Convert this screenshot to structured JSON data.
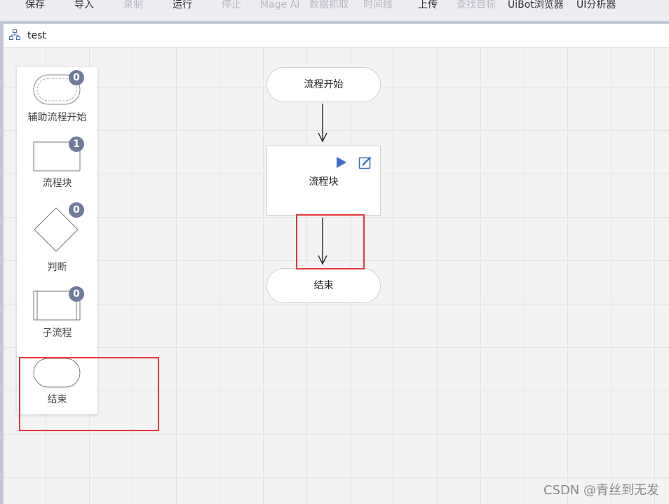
{
  "toolbar": {
    "items": [
      {
        "label": "保存",
        "enabled": true
      },
      {
        "label": "导入",
        "enabled": true
      },
      {
        "label": "录制",
        "enabled": false
      },
      {
        "label": "运行",
        "enabled": true
      },
      {
        "label": "停止",
        "enabled": false
      },
      {
        "label": "Mage AI",
        "enabled": false
      },
      {
        "label": "数据抓取",
        "enabled": false
      },
      {
        "label": "时间线",
        "enabled": false
      },
      {
        "label": "上传",
        "enabled": true
      },
      {
        "label": "查找目标",
        "enabled": false
      },
      {
        "label": "UiBot浏览器",
        "enabled": true
      },
      {
        "label": "UI分析器",
        "enabled": true
      }
    ]
  },
  "tab": {
    "title": "test",
    "icon": "flowchart-icon"
  },
  "palette": {
    "items": [
      {
        "label": "辅助流程开始",
        "count": "0",
        "shape": "dashed-rounded"
      },
      {
        "label": "流程块",
        "count": "1",
        "shape": "rectangle"
      },
      {
        "label": "判断",
        "count": "0",
        "shape": "diamond"
      },
      {
        "label": "子流程",
        "count": "0",
        "shape": "subprocess"
      },
      {
        "label": "结束",
        "count": "",
        "shape": "rounded"
      }
    ]
  },
  "flow": {
    "start_label": "流程开始",
    "block_label": "流程块",
    "end_label": "结束",
    "block_icons": [
      "play-icon",
      "edit-icon"
    ]
  },
  "colors": {
    "highlight": "#e5393a",
    "badge": "#6f7b9a",
    "accent_icon": "#3b6fc9"
  },
  "watermark": "CSDN @青丝到无发"
}
